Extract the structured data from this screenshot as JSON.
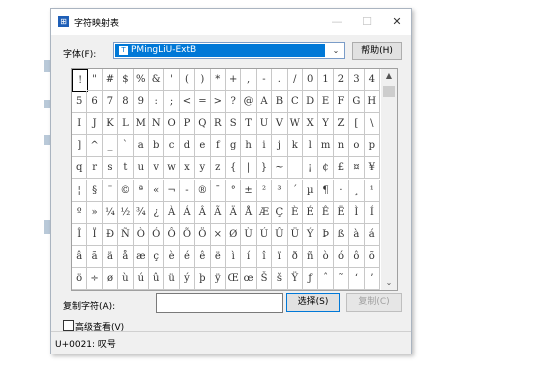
{
  "window": {
    "title": "字符映射表",
    "minimize_glyph": "—",
    "maximize_glyph": "☐",
    "close_glyph": "✕"
  },
  "font_row": {
    "label": "字体(F):",
    "selected_font": "PMingLiU-ExtB",
    "font_type_glyph": "T",
    "dropdown_glyph": "⌄",
    "help_button": "帮助(H)"
  },
  "grid": {
    "selected_char": "!",
    "rows": [
      [
        "!",
        "\"",
        "#",
        "$",
        "%",
        "&",
        "'",
        "(",
        ")",
        "*",
        "+",
        ",",
        "-",
        ".",
        "/",
        "0",
        "1",
        "2",
        "3",
        "4"
      ],
      [
        "5",
        "6",
        "7",
        "8",
        "9",
        ":",
        ";",
        "<",
        "=",
        ">",
        "?",
        "@",
        "A",
        "B",
        "C",
        "D",
        "E",
        "F",
        "G",
        "H"
      ],
      [
        "I",
        "J",
        "K",
        "L",
        "M",
        "N",
        "O",
        "P",
        "Q",
        "R",
        "S",
        "T",
        "U",
        "V",
        "W",
        "X",
        "Y",
        "Z",
        "[",
        "\\"
      ],
      [
        "]",
        "^",
        "_",
        "`",
        "a",
        "b",
        "c",
        "d",
        "e",
        "f",
        "g",
        "h",
        "i",
        "j",
        "k",
        "l",
        "m",
        "n",
        "o",
        "p"
      ],
      [
        "q",
        "r",
        "s",
        "t",
        "u",
        "v",
        "w",
        "x",
        "y",
        "z",
        "{",
        "|",
        "}",
        "~",
        "",
        "¡",
        "¢",
        "£",
        "¤",
        "¥"
      ],
      [
        "¦",
        "§",
        "¨",
        "©",
        "ª",
        "«",
        "¬",
        "-",
        "®",
        "¯",
        "°",
        "±",
        "²",
        "³",
        "´",
        "µ",
        "¶",
        "·",
        "¸",
        "¹"
      ],
      [
        "º",
        "»",
        "¼",
        "½",
        "¾",
        "¿",
        "À",
        "Á",
        "Â",
        "Ã",
        "Ä",
        "Å",
        "Æ",
        "Ç",
        "È",
        "É",
        "Ê",
        "Ë",
        "Ì",
        "Í"
      ],
      [
        "Î",
        "Ï",
        "Ð",
        "Ñ",
        "Ò",
        "Ó",
        "Ô",
        "Õ",
        "Ö",
        "×",
        "Ø",
        "Ù",
        "Ú",
        "Û",
        "Ü",
        "Ý",
        "Þ",
        "ß",
        "à",
        "á"
      ],
      [
        "â",
        "ã",
        "ä",
        "å",
        "æ",
        "ç",
        "è",
        "é",
        "ê",
        "ë",
        "ì",
        "í",
        "î",
        "ï",
        "ð",
        "ñ",
        "ò",
        "ó",
        "ô",
        "õ"
      ],
      [
        "ö",
        "÷",
        "ø",
        "ù",
        "ú",
        "û",
        "ü",
        "ý",
        "þ",
        "ÿ",
        "Œ",
        "œ",
        "Š",
        "š",
        "Ÿ",
        "ƒ",
        "ˆ",
        "˜",
        "‘",
        "’"
      ]
    ],
    "scroll_up_glyph": "▲",
    "scroll_down_glyph": "⌄"
  },
  "copy_row": {
    "label": "复制字符(A):",
    "value": "",
    "select_button": "选择(S)",
    "copy_button": "复制(C)"
  },
  "advanced_view": {
    "label": "高级查看(V)",
    "checked": false
  },
  "status_bar": {
    "text": "U+0021: 叹号"
  },
  "colors": {
    "selection": "#0078d7",
    "window_bg": "#f0f0f0",
    "focused_button_border": "#0078d7"
  }
}
